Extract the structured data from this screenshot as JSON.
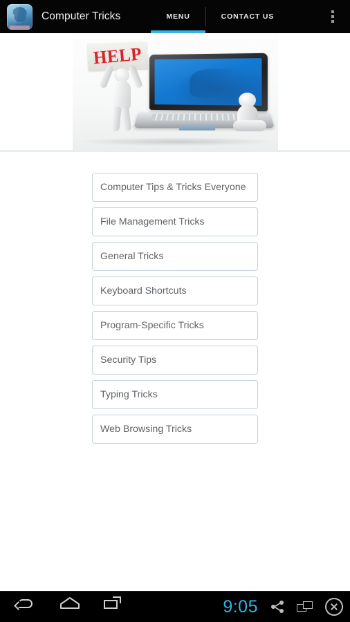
{
  "header": {
    "app_icon": "hand-palm-app-icon",
    "title": "Computer Tricks",
    "tabs": [
      {
        "label": "MENU",
        "active": true
      },
      {
        "label": "CONTACT US",
        "active": false
      }
    ],
    "overflow_icon": "overflow-menu-icon",
    "background_color": "#050505",
    "accent_color": "#35b4e3"
  },
  "hero": {
    "sign_text": "HELP",
    "alt": "3D white figures with laptop and HELP sign",
    "sign_text_color": "#d8232a",
    "screen_color": "#1479d2"
  },
  "menu": {
    "items": [
      {
        "label": "Computer Tips & Tricks Everyone"
      },
      {
        "label": "File Management Tricks"
      },
      {
        "label": "General Tricks"
      },
      {
        "label": "Keyboard Shortcuts"
      },
      {
        "label": "Program-Specific Tricks"
      },
      {
        "label": "Security Tips"
      },
      {
        "label": "Typing Tricks"
      },
      {
        "label": "Web Browsing Tricks"
      }
    ],
    "border_color": "#c3d2dc",
    "text_color": "#5f6367"
  },
  "sysbar": {
    "back_icon": "back-arrow-icon",
    "home_icon": "home-icon",
    "recents_icon": "recent-apps-icon",
    "clock": "9:05",
    "share_icon": "share-icon",
    "window_icon": "window-resize-icon",
    "close_icon": "close-circle-icon",
    "clock_color": "#2db5e8"
  }
}
